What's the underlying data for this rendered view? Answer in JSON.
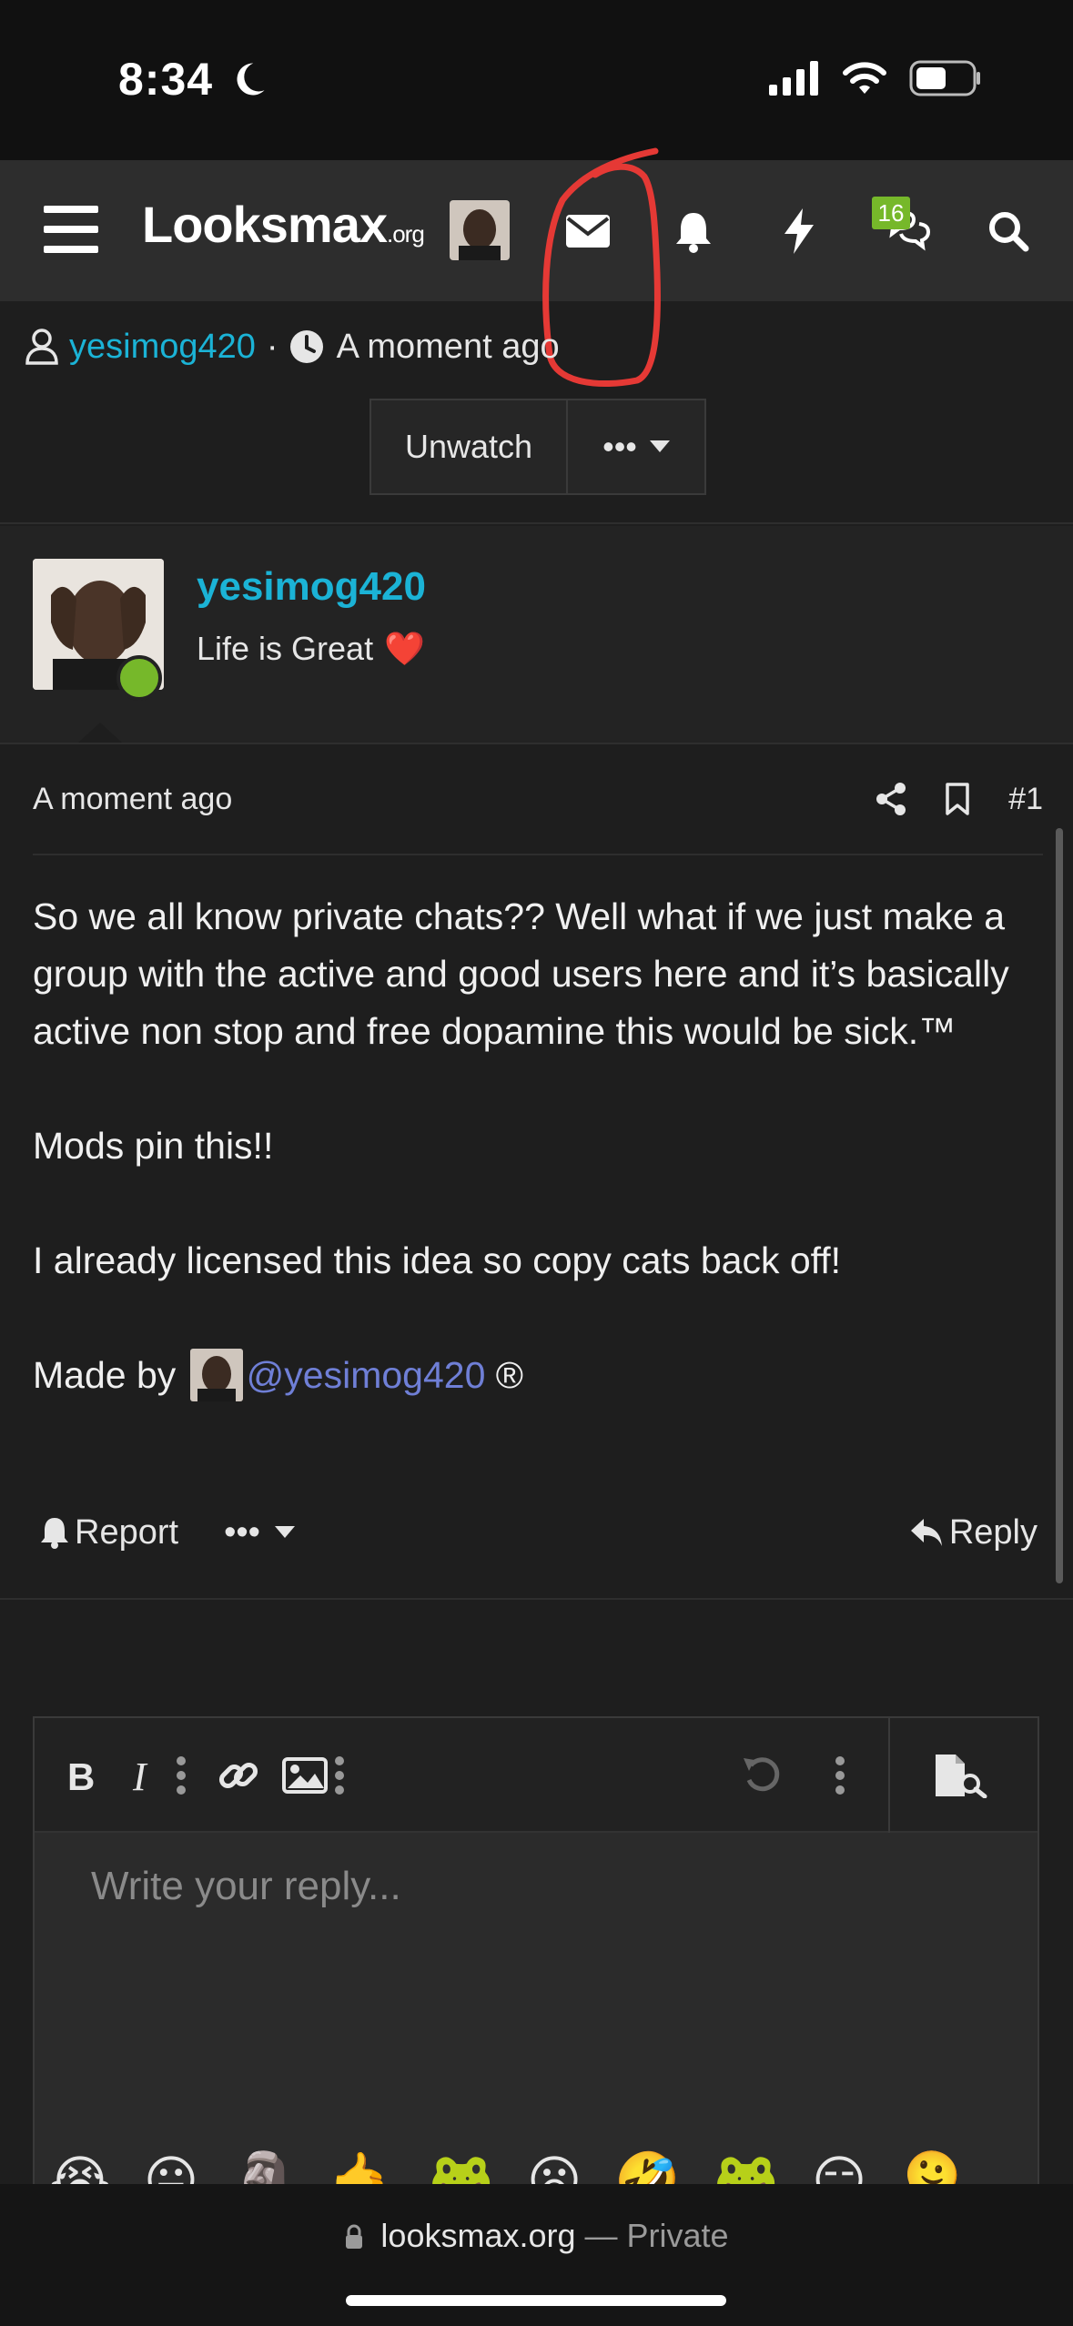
{
  "status_bar": {
    "time": "8:34"
  },
  "header": {
    "logo_main": "Looksmax",
    "logo_suffix": ".org",
    "conversations_badge": "16",
    "icons": [
      "menu-icon",
      "envelope-icon",
      "bell-icon",
      "bolt-icon",
      "chat-bubbles-icon",
      "search-icon"
    ]
  },
  "thread": {
    "author": "yesimog420",
    "separator": "·",
    "time": "A moment ago",
    "unwatch_label": "Unwatch",
    "more_label": "•••"
  },
  "post": {
    "author_name": "yesimog420",
    "author_title": "Life is Great",
    "author_title_emoji": "❤️",
    "time": "A moment ago",
    "number": "#1",
    "paragraph_1": "So we all know private chats?? Well what if we just make a group with the active and good users here and it’s basically active non stop and free dopamine this would be sick.™",
    "paragraph_2": "Mods pin this!!",
    "paragraph_3": "I already licensed this idea so copy cats back off!",
    "made_by_prefix": "Made by",
    "mention": "@yesimog420",
    "made_by_suffix": "®",
    "report_label": "Report",
    "more_label": "•••",
    "reply_label": "Reply"
  },
  "editor": {
    "placeholder": "Write your reply...",
    "toolbar": [
      "bold-icon",
      "italic-icon",
      "more-vertical-icon",
      "link-icon",
      "image-icon",
      "more-vertical-icon",
      "undo-icon",
      "more-vertical-icon",
      "preview-icon"
    ],
    "emojis": [
      "😭",
      "😛",
      "🗿",
      "🤙",
      "🐸",
      "😦",
      "🤣",
      "🐸",
      "😏",
      "🫠"
    ]
  },
  "browser": {
    "domain": "looksmax.org",
    "mode": "— Private"
  },
  "colors": {
    "accent_link": "#1bb3d6",
    "mention": "#6f7fd6",
    "online": "#76b82a",
    "annotation": "#e53935"
  }
}
